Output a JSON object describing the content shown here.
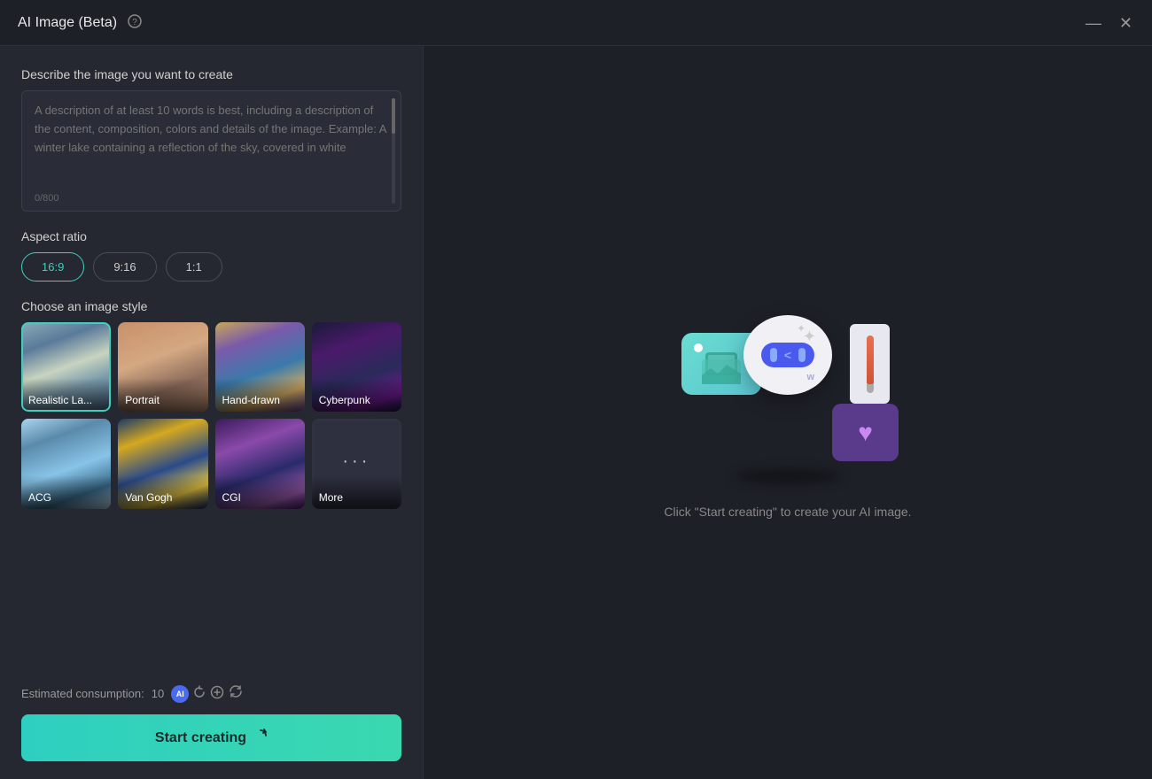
{
  "titleBar": {
    "title": "AI Image (Beta)",
    "helpIcon": "?",
    "minimizeIcon": "—",
    "closeIcon": "✕"
  },
  "leftPanel": {
    "descriptionSection": {
      "label": "Describe the image you want to create",
      "placeholder": "A description of at least 10 words is best, including a description of the content, composition, colors and details of the image. Example: A winter lake containing a reflection of the sky, covered in white",
      "charCount": "0/800"
    },
    "aspectRatioSection": {
      "label": "Aspect ratio",
      "options": [
        "16:9",
        "9:16",
        "1:1"
      ],
      "selected": "16:9"
    },
    "imageStyleSection": {
      "label": "Choose an image style",
      "styles": [
        {
          "id": "realistic",
          "label": "Realistic La...",
          "selected": true
        },
        {
          "id": "portrait",
          "label": "Portrait",
          "selected": false
        },
        {
          "id": "handdrawn",
          "label": "Hand-drawn",
          "selected": false
        },
        {
          "id": "cyberpunk",
          "label": "Cyberpunk",
          "selected": false
        },
        {
          "id": "acg",
          "label": "ACG",
          "selected": false
        },
        {
          "id": "vangogh",
          "label": "Van Gogh",
          "selected": false
        },
        {
          "id": "cgi",
          "label": "CGI",
          "selected": false
        },
        {
          "id": "more",
          "label": "More",
          "selected": false
        }
      ]
    },
    "consumption": {
      "label": "Estimated consumption:",
      "value": "10"
    },
    "startButton": {
      "label": "Start creating"
    }
  },
  "rightPanel": {
    "placeholderText": "Click \"Start creating\" to create your AI image."
  }
}
